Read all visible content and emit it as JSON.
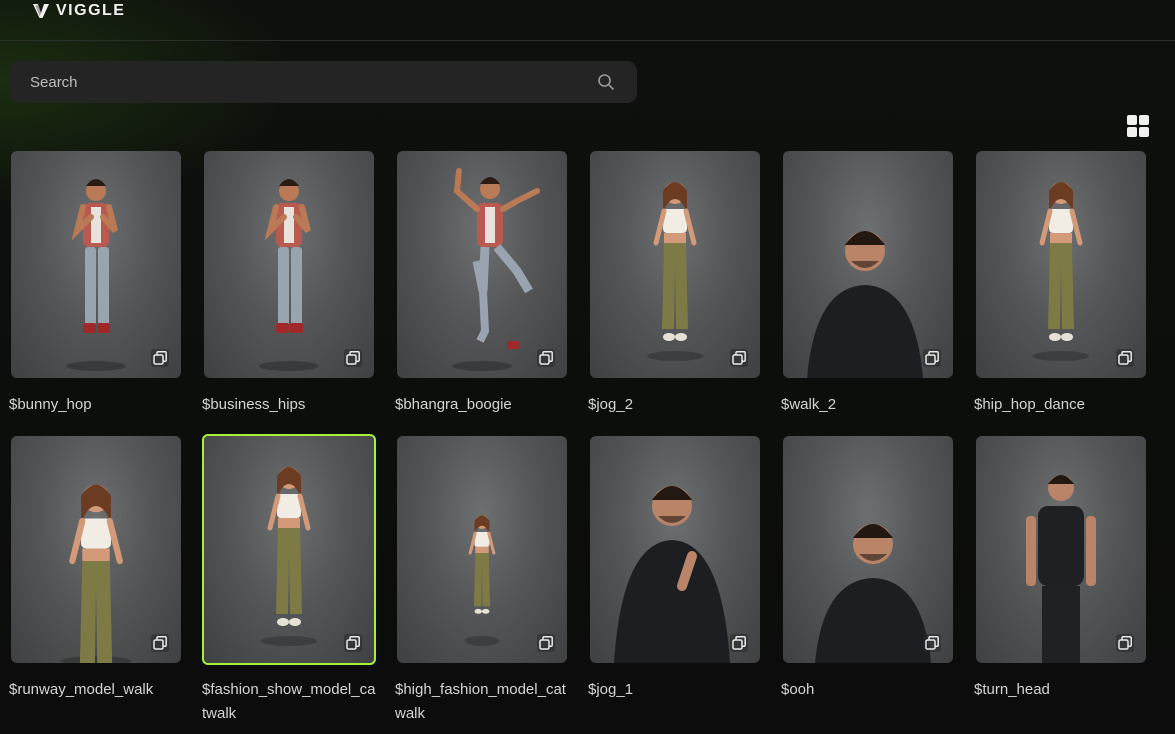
{
  "brand": {
    "name": "VIGGLE"
  },
  "search": {
    "placeholder": "Search"
  },
  "view_toggle": {
    "icon": "grid-view-icon"
  },
  "templates": [
    {
      "label": "$bunny_hop",
      "figure": "boy",
      "pose": "a"
    },
    {
      "label": "$business_hips",
      "figure": "boy",
      "pose": "b"
    },
    {
      "label": "$bhangra_boogie",
      "figure": "boy",
      "pose": "c"
    },
    {
      "label": "$jog_2",
      "figure": "girl",
      "pose": "a"
    },
    {
      "label": "$walk_2",
      "figure": "man",
      "pose": "bust"
    },
    {
      "label": "$hip_hop_dance",
      "figure": "girl",
      "pose": "b"
    },
    {
      "label": "$runway_model_walk",
      "figure": "girl",
      "pose": "close"
    },
    {
      "label": "$fashion_show_model_catwalk",
      "figure": "girl",
      "pose": "c",
      "selected": true
    },
    {
      "label": "$high_fashion_model_catwalk",
      "figure": "girl",
      "pose": "far"
    },
    {
      "label": "$jog_1",
      "figure": "man",
      "pose": "wave"
    },
    {
      "label": "$ooh",
      "figure": "man",
      "pose": "tilt"
    },
    {
      "label": "$turn_head",
      "figure": "man",
      "pose": "full"
    }
  ],
  "colors": {
    "accent_selected": "#a6ef3a",
    "card_bg": "#55575a",
    "page_bg": "#0c0d0c"
  }
}
